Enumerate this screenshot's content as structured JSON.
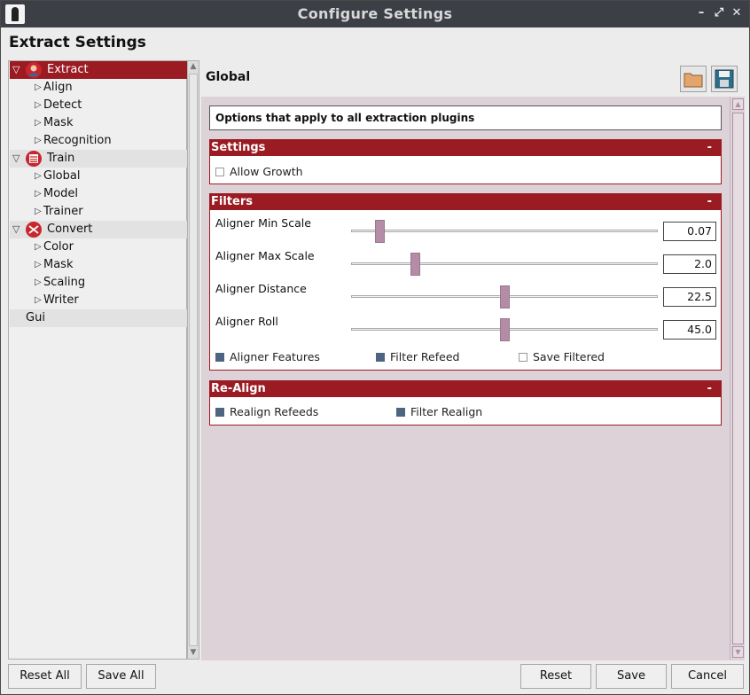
{
  "window": {
    "title": "Configure Settings",
    "minimize": "–",
    "maximize": "⤢",
    "close": "✕"
  },
  "header": {
    "title": "Extract Settings"
  },
  "tree": {
    "extract": {
      "label": "Extract",
      "children": [
        "Align",
        "Detect",
        "Mask",
        "Recognition"
      ]
    },
    "train": {
      "label": "Train",
      "children": [
        "Global",
        "Model",
        "Trainer"
      ]
    },
    "convert": {
      "label": "Convert",
      "children": [
        "Color",
        "Mask",
        "Scaling",
        "Writer"
      ]
    },
    "gui": {
      "label": "Gui"
    }
  },
  "panel": {
    "title": "Global",
    "description": "Options that apply to all extraction plugins",
    "settings": {
      "title": "Settings",
      "collapse": "-",
      "allow_growth": {
        "label": "Allow Growth",
        "checked": false
      }
    },
    "filters": {
      "title": "Filters",
      "collapse": "-",
      "sliders": [
        {
          "label": "Aligner Min Scale",
          "value": "0.07",
          "fraction": 0.08
        },
        {
          "label": "Aligner Max Scale",
          "value": "2.0",
          "fraction": 0.2
        },
        {
          "label": "Aligner Distance",
          "value": "22.5",
          "fraction": 0.5
        },
        {
          "label": "Aligner Roll",
          "value": "45.0",
          "fraction": 0.5
        }
      ],
      "checks": [
        {
          "label": "Aligner Features",
          "checked": true
        },
        {
          "label": "Filter Refeed",
          "checked": true
        },
        {
          "label": "Save Filtered",
          "checked": false
        }
      ]
    },
    "realign": {
      "title": "Re-Align",
      "collapse": "-",
      "checks": [
        {
          "label": "Realign Refeeds",
          "checked": true
        },
        {
          "label": "Filter Realign",
          "checked": true
        }
      ]
    }
  },
  "buttons": {
    "reset_all": "Reset All",
    "save_all": "Save All",
    "reset": "Reset",
    "save": "Save",
    "cancel": "Cancel"
  },
  "colors": {
    "accent": "#9b1b22",
    "content_bg": "#dcd2d8",
    "slider_handle": "#b48ca6",
    "checkbox_on": "#4d6580"
  }
}
